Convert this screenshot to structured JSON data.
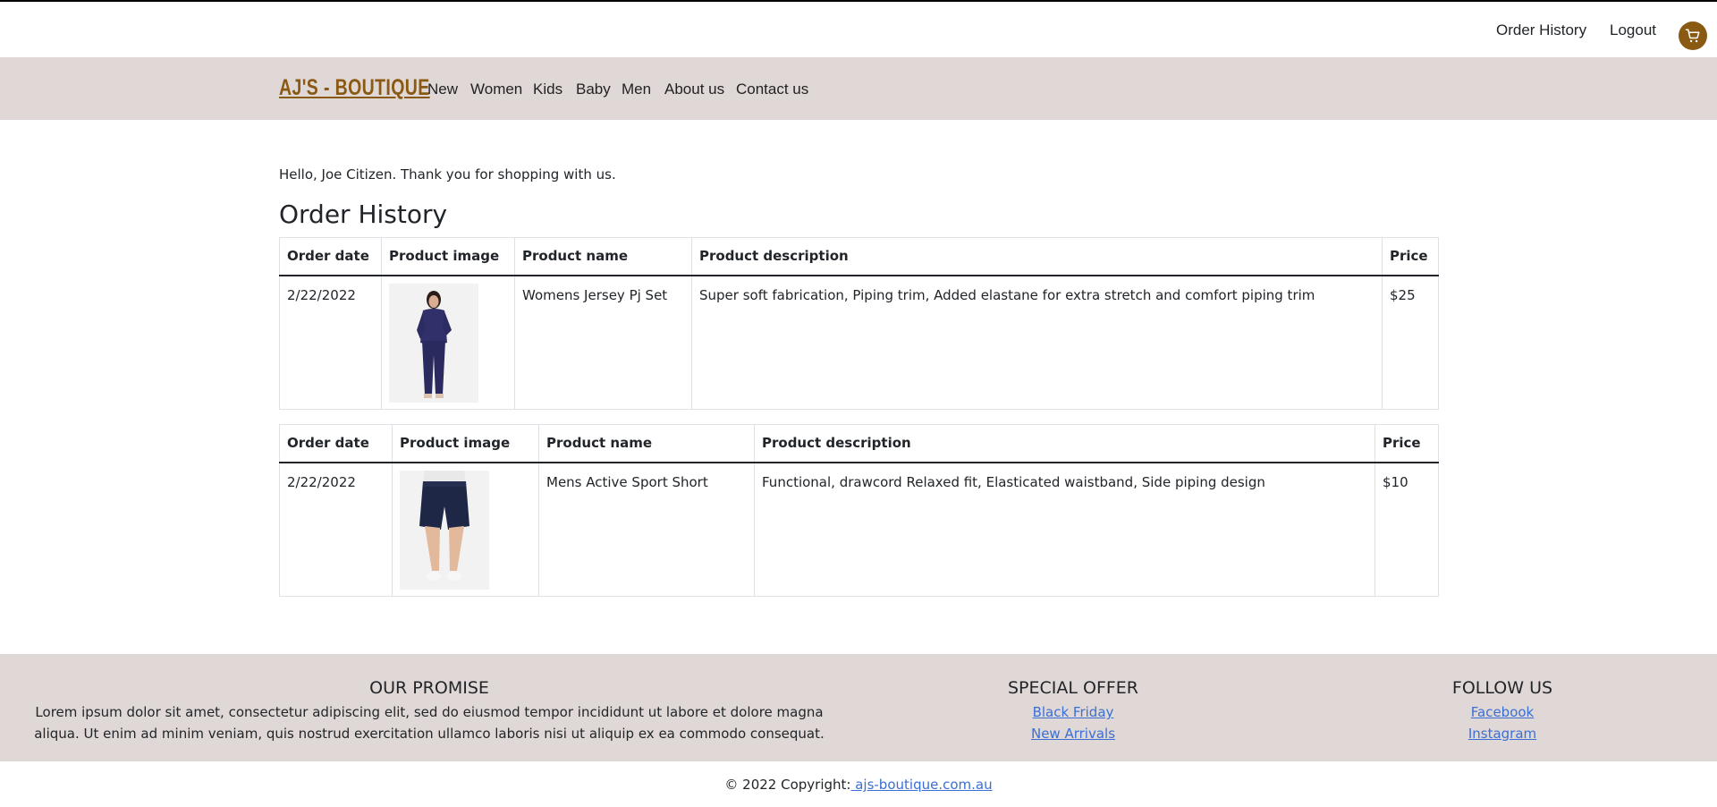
{
  "top_links": {
    "order_history": "Order History",
    "logout": "Logout"
  },
  "brand": "AJ'S - BOUTIQUE",
  "nav": [
    "New",
    "Women",
    "Kids",
    "Baby",
    "Men",
    "About us",
    "Contact us"
  ],
  "greeting": "Hello, Joe Citizen. Thank you for shopping with us.",
  "page_title": "Order History",
  "table_headers": {
    "order_date": "Order date",
    "product_image": "Product image",
    "product_name": "Product name",
    "product_description": "Product description",
    "price": "Price"
  },
  "orders": [
    {
      "order_date": "2/22/2022",
      "product_name": "Womens Jersey Pj Set",
      "product_description": "Super soft fabrication, Piping trim, Added elastane for extra stretch and comfort piping trim",
      "price": "$25"
    },
    {
      "order_date": "2/22/2022",
      "product_name": "Mens Active Sport Short",
      "product_description": "Functional, drawcord Relaxed fit, Elasticated waistband, Side piping design",
      "price": "$10"
    }
  ],
  "footer": {
    "promise_title": "OUR PROMISE",
    "promise_text": "Lorem ipsum dolor sit amet, consectetur adipiscing elit, sed do eiusmod tempor incididunt ut labore et dolore magna aliqua. Ut enim ad minim veniam, quis nostrud exercitation ullamco laboris nisi ut aliquip ex ea commodo consequat.",
    "offer_title": "SPECIAL OFFER",
    "offer_links": [
      "Black Friday",
      "New Arrivals"
    ],
    "follow_title": "FOLLOW US",
    "follow_links": [
      "Facebook",
      "Instagram"
    ]
  },
  "copyright": {
    "text": "© 2022 Copyright:",
    "link": " ajs-boutique.com.au"
  },
  "colors": {
    "brand": "#8a5a14",
    "band": "#e0d8d6",
    "link": "#3b6fd4"
  },
  "icons": {
    "cart": "cart-icon"
  }
}
